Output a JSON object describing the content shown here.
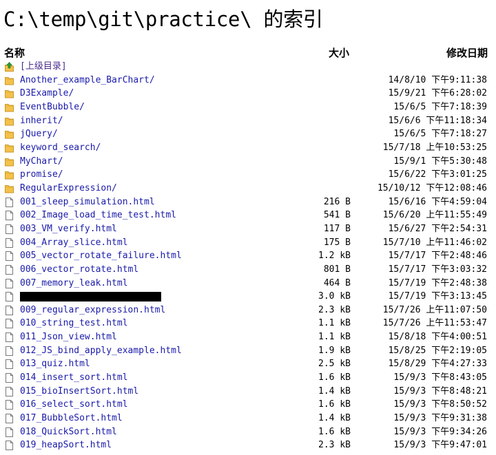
{
  "title": "C:\\temp\\git\\practice\\ 的索引",
  "headers": {
    "name": "名称",
    "size": "大小",
    "date": "修改日期"
  },
  "rows": [
    {
      "type": "parent",
      "name": "[上级目录]",
      "size": "",
      "date": ""
    },
    {
      "type": "folder",
      "name": "Another_example_BarChart/",
      "size": "",
      "date": "14/8/10 下午9:11:38"
    },
    {
      "type": "folder",
      "name": "D3Example/",
      "size": "",
      "date": "15/9/21 下午6:28:02"
    },
    {
      "type": "folder",
      "name": "EventBubble/",
      "size": "",
      "date": "15/6/5 下午7:18:39"
    },
    {
      "type": "folder",
      "name": "inherit/",
      "size": "",
      "date": "15/6/6 下午11:18:34"
    },
    {
      "type": "folder",
      "name": "jQuery/",
      "size": "",
      "date": "15/6/5 下午7:18:27"
    },
    {
      "type": "folder",
      "name": "keyword_search/",
      "size": "",
      "date": "15/7/18 上午10:53:25"
    },
    {
      "type": "folder",
      "name": "MyChart/",
      "size": "",
      "date": "15/9/1 下午5:30:48"
    },
    {
      "type": "folder",
      "name": "promise/",
      "size": "",
      "date": "15/6/22 下午3:01:25"
    },
    {
      "type": "folder",
      "name": "RegularExpression/",
      "size": "",
      "date": "15/10/12 下午12:08:46"
    },
    {
      "type": "file",
      "name": "001_sleep_simulation.html",
      "size": "216 B",
      "date": "15/6/16 下午4:59:04"
    },
    {
      "type": "file",
      "name": "002_Image_load_time_test.html",
      "size": "541 B",
      "date": "15/6/20 上午11:55:49"
    },
    {
      "type": "file",
      "name": "003_VM_verify.html",
      "size": "117 B",
      "date": "15/6/27 下午2:54:31"
    },
    {
      "type": "file",
      "name": "004_Array_slice.html",
      "size": "175 B",
      "date": "15/7/10 上午11:46:02"
    },
    {
      "type": "file",
      "name": "005_vector_rotate_failure.html",
      "size": "1.2 kB",
      "date": "15/7/17 下午2:48:46"
    },
    {
      "type": "file",
      "name": "006_vector_rotate.html",
      "size": "801 B",
      "date": "15/7/17 下午3:03:32"
    },
    {
      "type": "file",
      "name": "007_memory_leak.html",
      "size": "464 B",
      "date": "15/7/19 下午2:48:38"
    },
    {
      "type": "redacted",
      "name": "",
      "size": "3.0 kB",
      "date": "15/7/19 下午3:13:45"
    },
    {
      "type": "file",
      "name": "009_regular_expression.html",
      "size": "2.3 kB",
      "date": "15/7/26 上午11:07:50"
    },
    {
      "type": "file",
      "name": "010_string_test.html",
      "size": "1.1 kB",
      "date": "15/7/26 上午11:53:47"
    },
    {
      "type": "file",
      "name": "011_Json_view.html",
      "size": "1.1 kB",
      "date": "15/8/18 下午4:00:51"
    },
    {
      "type": "file",
      "name": "012_JS_bind_apply_example.html",
      "size": "1.9 kB",
      "date": "15/8/25 下午2:19:05"
    },
    {
      "type": "file",
      "name": "013_quiz.html",
      "size": "2.5 kB",
      "date": "15/8/29 下午4:27:33"
    },
    {
      "type": "file",
      "name": "014_insert_sort.html",
      "size": "1.6 kB",
      "date": "15/9/3 下午8:43:05"
    },
    {
      "type": "file",
      "name": "015_bioInsertSort.html",
      "size": "1.4 kB",
      "date": "15/9/3 下午8:48:21"
    },
    {
      "type": "file",
      "name": "016_select_sort.html",
      "size": "1.6 kB",
      "date": "15/9/3 下午8:50:52"
    },
    {
      "type": "file",
      "name": "017_BubbleSort.html",
      "size": "1.4 kB",
      "date": "15/9/3 下午9:31:38"
    },
    {
      "type": "file",
      "name": "018_QuickSort.html",
      "size": "1.6 kB",
      "date": "15/9/3 下午9:34:26"
    },
    {
      "type": "file",
      "name": "019_heapSort.html",
      "size": "2.3 kB",
      "date": "15/9/3 下午9:47:01"
    }
  ],
  "colors": {
    "link": "#1a1aaa",
    "parent_link": "#4b2b8e",
    "folder": "#f4c24a",
    "parent_arrow": "#2e9e2e"
  },
  "icons": {
    "parent": "up-arrow-icon",
    "folder": "folder-icon",
    "file": "file-icon"
  }
}
